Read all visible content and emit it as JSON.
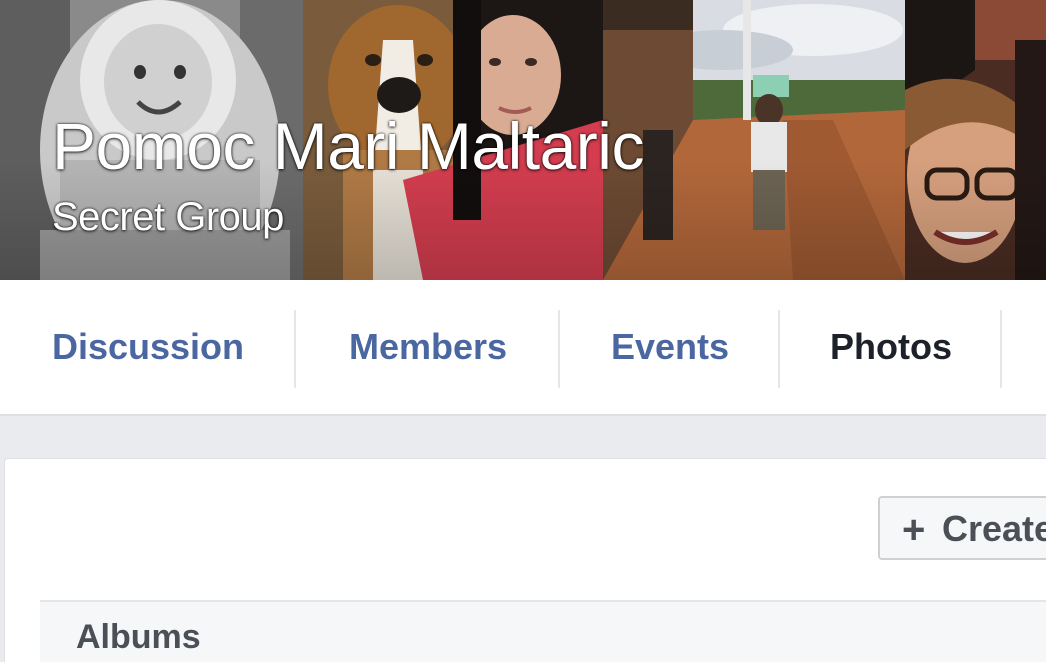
{
  "group": {
    "name": "Pomoc Mari Maltaric",
    "privacy": "Secret Group"
  },
  "tabs": [
    {
      "label": "Discussion",
      "active": false
    },
    {
      "label": "Members",
      "active": false
    },
    {
      "label": "Events",
      "active": false
    },
    {
      "label": "Photos",
      "active": true
    }
  ],
  "toolbar": {
    "create_icon": "plus-icon",
    "create_label": "Create"
  },
  "albums": {
    "heading": "Albums"
  },
  "colors": {
    "link_blue": "#4b67a1",
    "active_tab": "#1d2129",
    "page_bg": "#e9ebee"
  }
}
